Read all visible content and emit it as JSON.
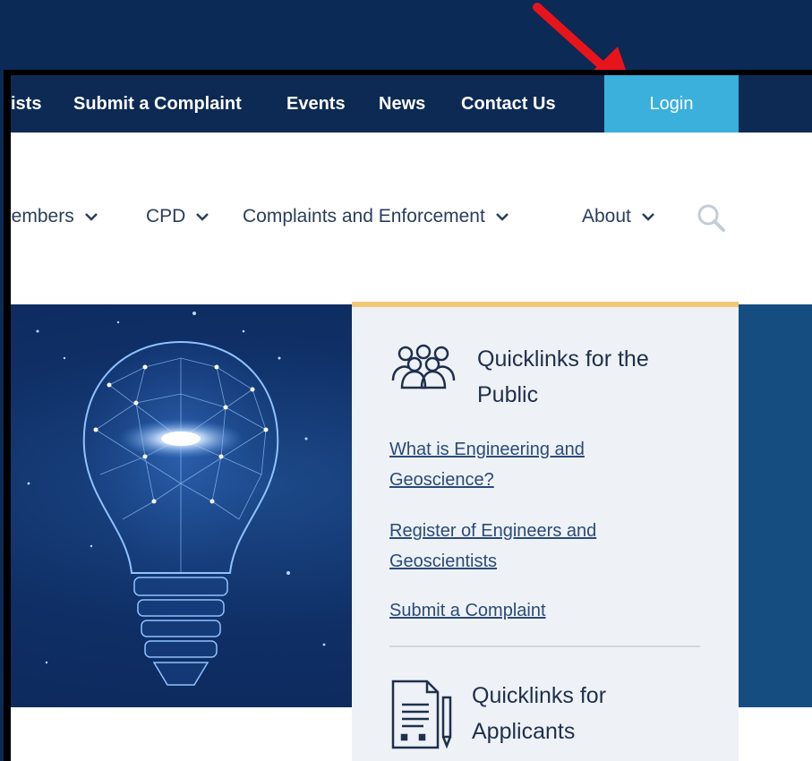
{
  "utility_nav": {
    "items": [
      "ists",
      "Submit a Complaint",
      "Events",
      "News",
      "Contact Us"
    ],
    "login": "Login"
  },
  "main_nav": {
    "items": [
      "lembers",
      "CPD",
      "Complaints and Enforcement",
      "About"
    ]
  },
  "quicklinks_public": {
    "title": "Quicklinks for the Public",
    "links": [
      "What is Engineering and Geoscience?",
      "Register of Engineers and Geoscientists",
      "Submit a Complaint"
    ]
  },
  "quicklinks_applicants": {
    "title": "Quicklinks for Applicants"
  },
  "colors": {
    "navy": "#0d2a55",
    "login": "#3bb0dc",
    "panel": "#eef2f6",
    "panel_accent": "#f2c777",
    "annotation_arrow": "#e8141c"
  }
}
